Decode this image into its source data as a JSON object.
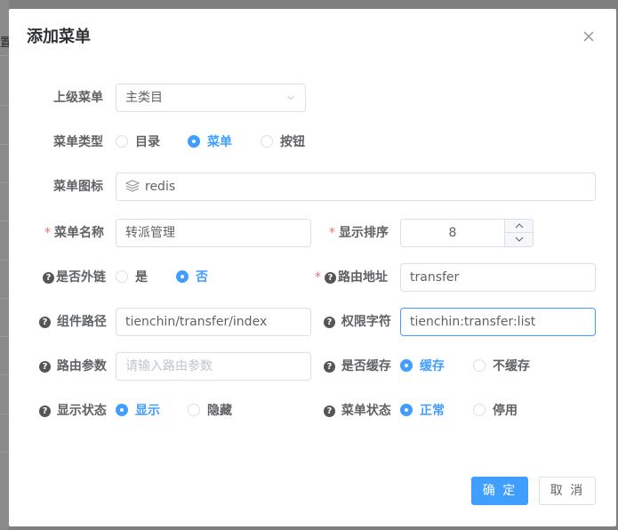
{
  "background": {
    "partial_text": "置"
  },
  "dialog": {
    "title": "添加菜单",
    "close_label": "×"
  },
  "form": {
    "parent_menu": {
      "label": "上级菜单",
      "value": "主类目"
    },
    "menu_type": {
      "label": "菜单类型",
      "options": [
        "目录",
        "菜单",
        "按钮"
      ],
      "selected": "菜单"
    },
    "menu_icon": {
      "label": "菜单图标",
      "value": "redis",
      "icon": "stack-icon"
    },
    "menu_name": {
      "label": "菜单名称",
      "value": "转派管理",
      "required_mark": "*"
    },
    "display_order": {
      "label": "显示排序",
      "value": "8",
      "required_mark": "*"
    },
    "is_external": {
      "label": "是否外链",
      "options": [
        "是",
        "否"
      ],
      "selected": "否"
    },
    "route_path": {
      "label": "路由地址",
      "value": "transfer",
      "required_mark": "*"
    },
    "component_path": {
      "label": "组件路径",
      "value": "tienchin/transfer/index"
    },
    "permission": {
      "label": "权限字符",
      "value": "tienchin:transfer:list"
    },
    "route_params": {
      "label": "路由参数",
      "value": "",
      "placeholder": "请输入路由参数"
    },
    "is_cache": {
      "label": "是否缓存",
      "options": [
        "缓存",
        "不缓存"
      ],
      "selected": "缓存"
    },
    "visible": {
      "label": "显示状态",
      "options": [
        "显示",
        "隐藏"
      ],
      "selected": "显示"
    },
    "menu_status": {
      "label": "菜单状态",
      "options": [
        "正常",
        "停用"
      ],
      "selected": "正常"
    },
    "help_icon_glyph": "?"
  },
  "footer": {
    "confirm_label": "确 定",
    "cancel_label": "取 消"
  },
  "colors": {
    "primary": "#409eff",
    "required": "#f56c6c",
    "border": "#dcdfe6",
    "text": "#606266",
    "placeholder": "#c0c4cc"
  }
}
